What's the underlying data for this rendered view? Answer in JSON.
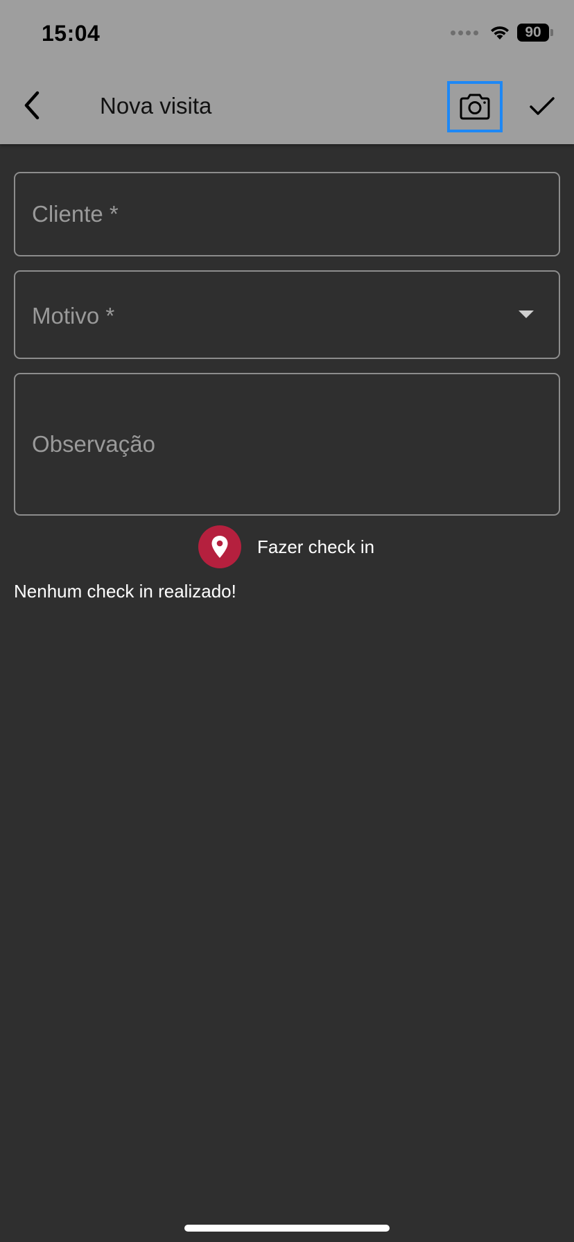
{
  "status_bar": {
    "time": "15:04",
    "battery_level": "90",
    "icons": [
      "signal-dots-icon",
      "wifi-icon",
      "battery-icon"
    ]
  },
  "app_bar": {
    "title": "Nova visita",
    "back_icon": "chevron-left-icon",
    "camera_icon": "camera-icon",
    "confirm_icon": "check-icon"
  },
  "form": {
    "cliente": {
      "label": "Cliente *",
      "value": ""
    },
    "motivo": {
      "label": "Motivo *",
      "value": "",
      "icon": "dropdown-arrow-icon"
    },
    "observacao": {
      "label": "Observação",
      "value": ""
    }
  },
  "checkin": {
    "button_label": "Fazer check in",
    "icon": "map-pin-icon",
    "status_text": "Nenhum check in realizado!"
  },
  "colors": {
    "header_bg": "#9e9e9e",
    "screen_bg": "#2f2f2f",
    "accent_pin": "#b5203e",
    "focus_outline": "#1e88f5",
    "field_border": "#8d8d8d"
  }
}
